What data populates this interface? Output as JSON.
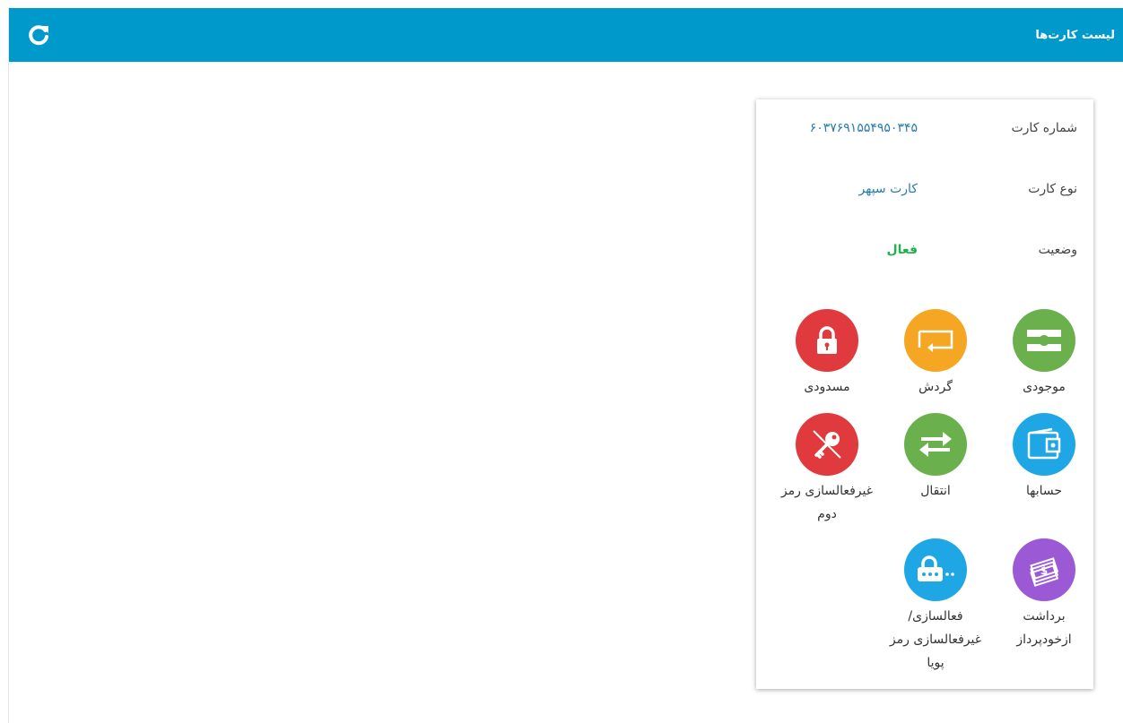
{
  "header": {
    "title": "لیست کارت‌ها",
    "refresh_icon": "refresh-icon",
    "bg_color": "#0099cc"
  },
  "card": {
    "card_number_label": "شماره کارت",
    "card_number": "۶۰۳۷۶۹۱۵۵۴۹۵۰۳۴۵",
    "card_type_label": "نوع کارت",
    "card_type": "کارت سپهر",
    "status_label": "وضعیت",
    "status": "فعال",
    "status_color": "#22b14c"
  },
  "actions": [
    {
      "label": "موجودی",
      "icon": "card-balance-icon",
      "color": "#6ab04c"
    },
    {
      "label": "گردش",
      "icon": "transactions-icon",
      "color": "#f5a623"
    },
    {
      "label": "مسدودی",
      "icon": "lock-icon",
      "color": "#e03a3e"
    },
    {
      "label": "حسابها",
      "icon": "wallet-icon",
      "color": "#1ea7e4"
    },
    {
      "label": "انتقال",
      "icon": "transfer-arrows-icon",
      "color": "#6ab04c"
    },
    {
      "label": "غیرفعالسازی رمز دوم",
      "icon": "key-disabled-icon",
      "color": "#e03a3e"
    },
    {
      "label": "برداشت ازخودپرداز",
      "icon": "cash-icon",
      "color": "#9b59d6"
    },
    {
      "label": "فعالسازی/ غیرفعالسازی رمز پویا",
      "icon": "dynamic-password-icon",
      "color": "#1ea7e4"
    }
  ]
}
